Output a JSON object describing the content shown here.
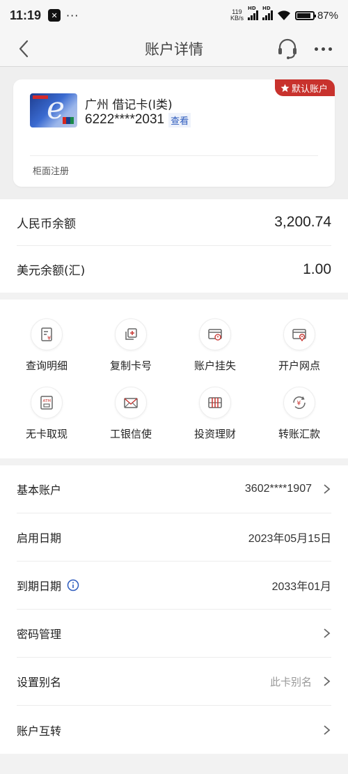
{
  "status": {
    "time": "11:19",
    "net_speed_top": "119",
    "net_speed_bottom": "KB/s",
    "hd1": "HD",
    "hd2": "HD",
    "battery": "87%"
  },
  "nav": {
    "title": "账户详情"
  },
  "card": {
    "badge": "默认账户",
    "name": "广州 借记卡(Ⅰ类)",
    "number": "6222****2031",
    "view_label": "查看",
    "registration": "柜面注册"
  },
  "balances": [
    {
      "label": "人民币余额",
      "amount": "3,200.74"
    },
    {
      "label": "美元余额(汇)",
      "amount": "1.00"
    }
  ],
  "functions": [
    {
      "label": "查询明细",
      "icon": "statement-icon"
    },
    {
      "label": "复制卡号",
      "icon": "copy-icon"
    },
    {
      "label": "账户挂失",
      "icon": "card-alert-icon"
    },
    {
      "label": "开户网点",
      "icon": "card-location-icon"
    },
    {
      "label": "无卡取现",
      "icon": "atm-icon"
    },
    {
      "label": "工银信使",
      "icon": "envelope-icon"
    },
    {
      "label": "投资理财",
      "icon": "abacus-icon"
    },
    {
      "label": "转账汇款",
      "icon": "transfer-icon"
    }
  ],
  "details": [
    {
      "label": "基本账户",
      "value": "3602****1907",
      "chevron": true
    },
    {
      "label": "启用日期",
      "value": "2023年05月15日",
      "chevron": false
    },
    {
      "label": "到期日期",
      "value": "2033年01月",
      "chevron": false,
      "info": true
    },
    {
      "label": "密码管理",
      "value": "",
      "chevron": true
    },
    {
      "label": "设置别名",
      "value": "此卡别名",
      "chevron": true
    },
    {
      "label": "账户互转",
      "value": "",
      "chevron": true
    }
  ],
  "colors": {
    "accent_red": "#c8322d",
    "link_blue": "#2d5bbd"
  }
}
